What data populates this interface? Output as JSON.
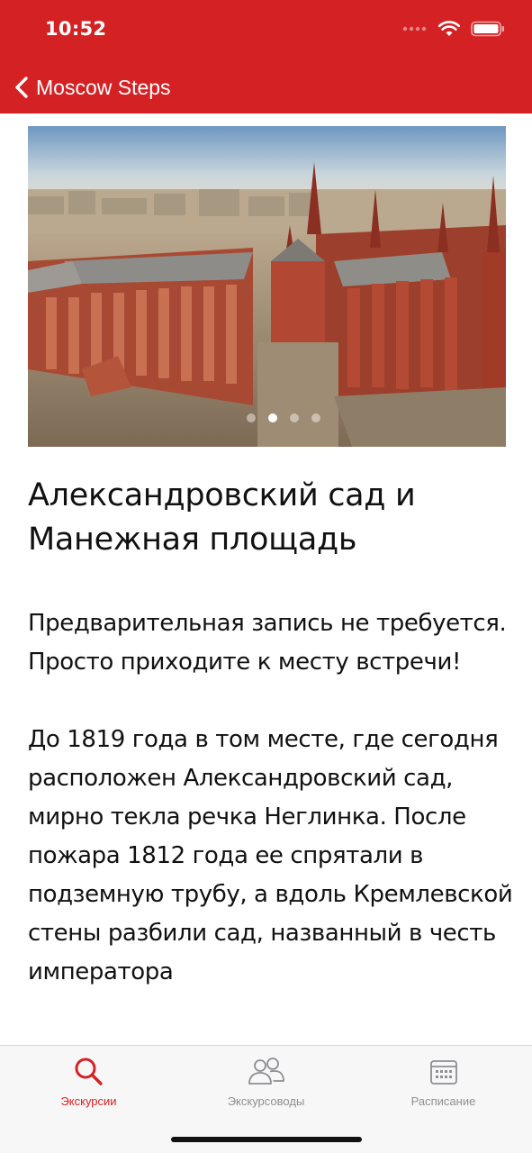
{
  "status_bar": {
    "time": "10:52"
  },
  "nav": {
    "back_label": "Moscow Steps"
  },
  "carousel": {
    "page_count": 4,
    "active_index": 1
  },
  "article": {
    "title": "Александровский сад и Манежная площадь",
    "paragraphs": [
      "Предварительная запись не требуется. Просто приходите к месту встречи!",
      "До 1819 года в том месте, где сегодня расположен Александровский сад, мирно текла речка Неглинка. После пожара 1812 года ее спрятали в подземную трубу, а вдоль Кремлевской стены разбили сад, названный в честь императора"
    ]
  },
  "tabs": [
    {
      "label": "Экскурсии",
      "icon": "search-icon",
      "active": true
    },
    {
      "label": "Экскурсоводы",
      "icon": "people-icon",
      "active": false
    },
    {
      "label": "Расписание",
      "icon": "calendar-icon",
      "active": false
    }
  ],
  "colors": {
    "accent": "#d42224",
    "inactive": "#8e8e93",
    "tabbar_bg": "#f7f7f7"
  }
}
